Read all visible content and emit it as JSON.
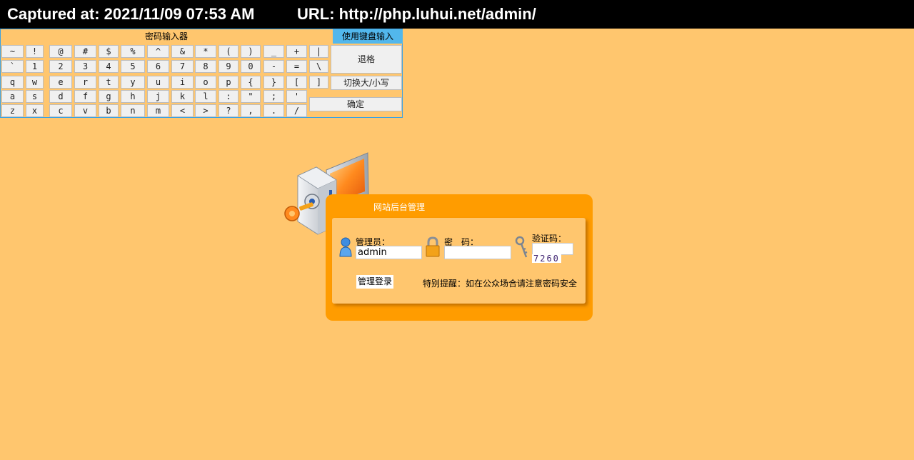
{
  "capture": {
    "captured_at": "Captured at: 2021/11/09 07:53 AM",
    "url": "URL: http://php.luhui.net/admin/"
  },
  "keyboard": {
    "title": "密码输入器",
    "use_keyboard": "使用键盘输入",
    "backspace": "退格",
    "toggle_case": "切换大/小写",
    "confirm": "确定",
    "rows": [
      [
        "~",
        "!",
        "@",
        "#",
        "$",
        "%",
        "^",
        "&",
        "*",
        "(",
        ")",
        "_",
        "+",
        "|"
      ],
      [
        "`",
        "1",
        "2",
        "3",
        "4",
        "5",
        "6",
        "7",
        "8",
        "9",
        "0",
        "-",
        "=",
        "\\"
      ],
      [
        "q",
        "w",
        "e",
        "r",
        "t",
        "y",
        "u",
        "i",
        "o",
        "p",
        "{",
        "}",
        "[",
        "]"
      ],
      [
        "a",
        "s",
        "d",
        "f",
        "g",
        "h",
        "j",
        "k",
        "l",
        ":",
        "\"",
        ";",
        "'"
      ],
      [
        "z",
        "x",
        "c",
        "v",
        "b",
        "n",
        "m",
        "<",
        ">",
        "?",
        ",",
        ".",
        "/"
      ]
    ]
  },
  "login": {
    "title": "网站后台管理",
    "admin_label": "管理员：",
    "admin_value": "admin",
    "password_label": "密　码：",
    "password_value": "",
    "captcha_label": "验证码：",
    "captcha_value": "",
    "captcha_code": "7260",
    "login_button": "管理登录",
    "notice": "特别提醒：如在公众场合请注意密码安全"
  },
  "colors": {
    "background": "#ffc66e",
    "panel": "#ff9c00",
    "keyboard_border": "#3ba2e4",
    "keyboard_highlight": "#52b7ec"
  }
}
